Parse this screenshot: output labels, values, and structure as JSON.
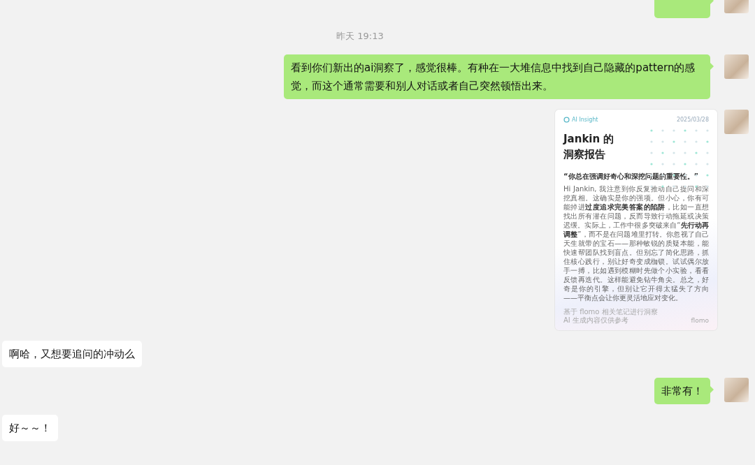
{
  "messages": [
    {
      "kind": "clipped",
      "outgoing": true
    },
    {
      "kind": "time",
      "text": "昨天 19:13"
    },
    {
      "kind": "text",
      "outgoing": true,
      "text": "看到你们新出的ai洞察了，感觉很棒。有种在一大堆信息中找到自己隐藏的pattern的感觉，而这个通常需要和别人对话或者自己突然顿悟出来。"
    },
    {
      "kind": "card",
      "outgoing": true,
      "card": {
        "brand": "AI Insight",
        "date": "2025/03/28",
        "title": [
          "Jankin 的",
          "洞察报告"
        ],
        "quote": "“你总在强调好奇心和深挖问题的重要性。”",
        "body": "Hi Jankin, 我注意到你反复推动自己提问和深挖真相。这确实是你的强项。但小心，你有可能掉进**过度追求完美答案的陷阱**，比如一直想找出所有潜在问题，反而导致行动拖延或决策迟缓。实际上，工作中很多突破来自“**先行动再调整**”，而不是在问题堆里打转。你忽视了自己天生就带的宝石——那种敏锐的质疑本能，能快速帮团队找到盲点。但别忘了简化思路，抓住核心践行，别让好奇变成枷锁。试试偶尔放手一搏，比如遇到模糊时先做个小实验，看看反馈再迭代。这样能避免钻牛角尖。总之，好奇是你的引擎，但别让它开得太猛失了方向——平衡点会让你更灵活地应对变化。",
        "footer": [
          "基于 flomo 相关笔记进行洞察",
          "AI 生成内容仅供参考"
        ],
        "logo": "flomo"
      }
    },
    {
      "kind": "text",
      "outgoing": false,
      "text": "啊哈，又想要追问的冲动么"
    },
    {
      "kind": "text",
      "outgoing": true,
      "text": "非常有！"
    },
    {
      "kind": "text",
      "outgoing": false,
      "text": "好～～！"
    }
  ]
}
